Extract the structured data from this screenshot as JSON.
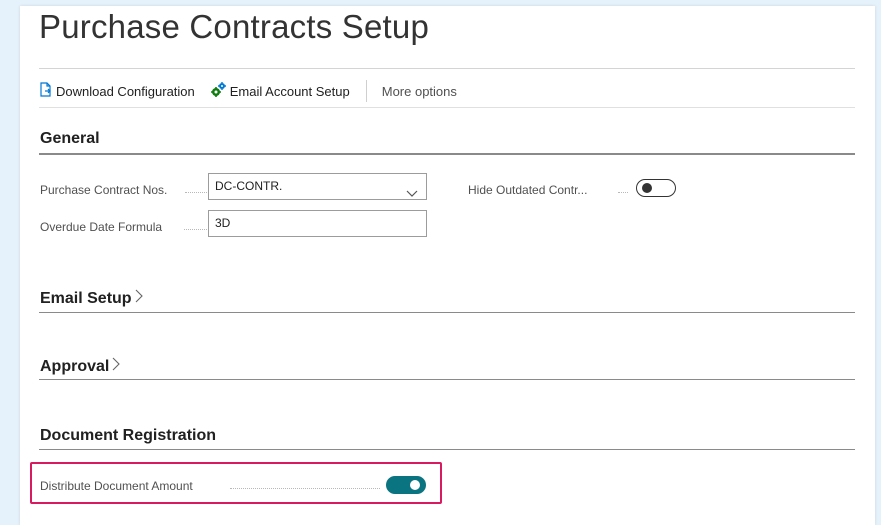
{
  "page": {
    "title": "Purchase Contracts Setup"
  },
  "actionbar": {
    "download_label": "Download Configuration",
    "email_account_label": "Email Account Setup",
    "more_label": "More options"
  },
  "sections": {
    "general": {
      "title": "General",
      "purchase_contract_nos_label": "Purchase Contract Nos.",
      "purchase_contract_nos_value": "DC-CONTR.",
      "overdue_date_formula_label": "Overdue Date Formula",
      "overdue_date_formula_value": "3D",
      "hide_outdated_label": "Hide Outdated Contr...",
      "hide_outdated_on": false
    },
    "email_setup": {
      "title": "Email Setup"
    },
    "approval": {
      "title": "Approval"
    },
    "document_registration": {
      "title": "Document Registration",
      "distribute_amount_label": "Distribute Document Amount",
      "distribute_amount_on": true
    }
  },
  "icons": {
    "download": "document-download-icon",
    "email_account": "gear-cluster-icon",
    "select": "chevron-down-icon",
    "collapsed_section": "chevron-right-icon"
  },
  "colors": {
    "background": "#e6f2fb",
    "toggle_on": "#0a7480",
    "highlight": "#d81b60",
    "icon_blue": "#0078d4",
    "icon_green": "#107c10"
  }
}
